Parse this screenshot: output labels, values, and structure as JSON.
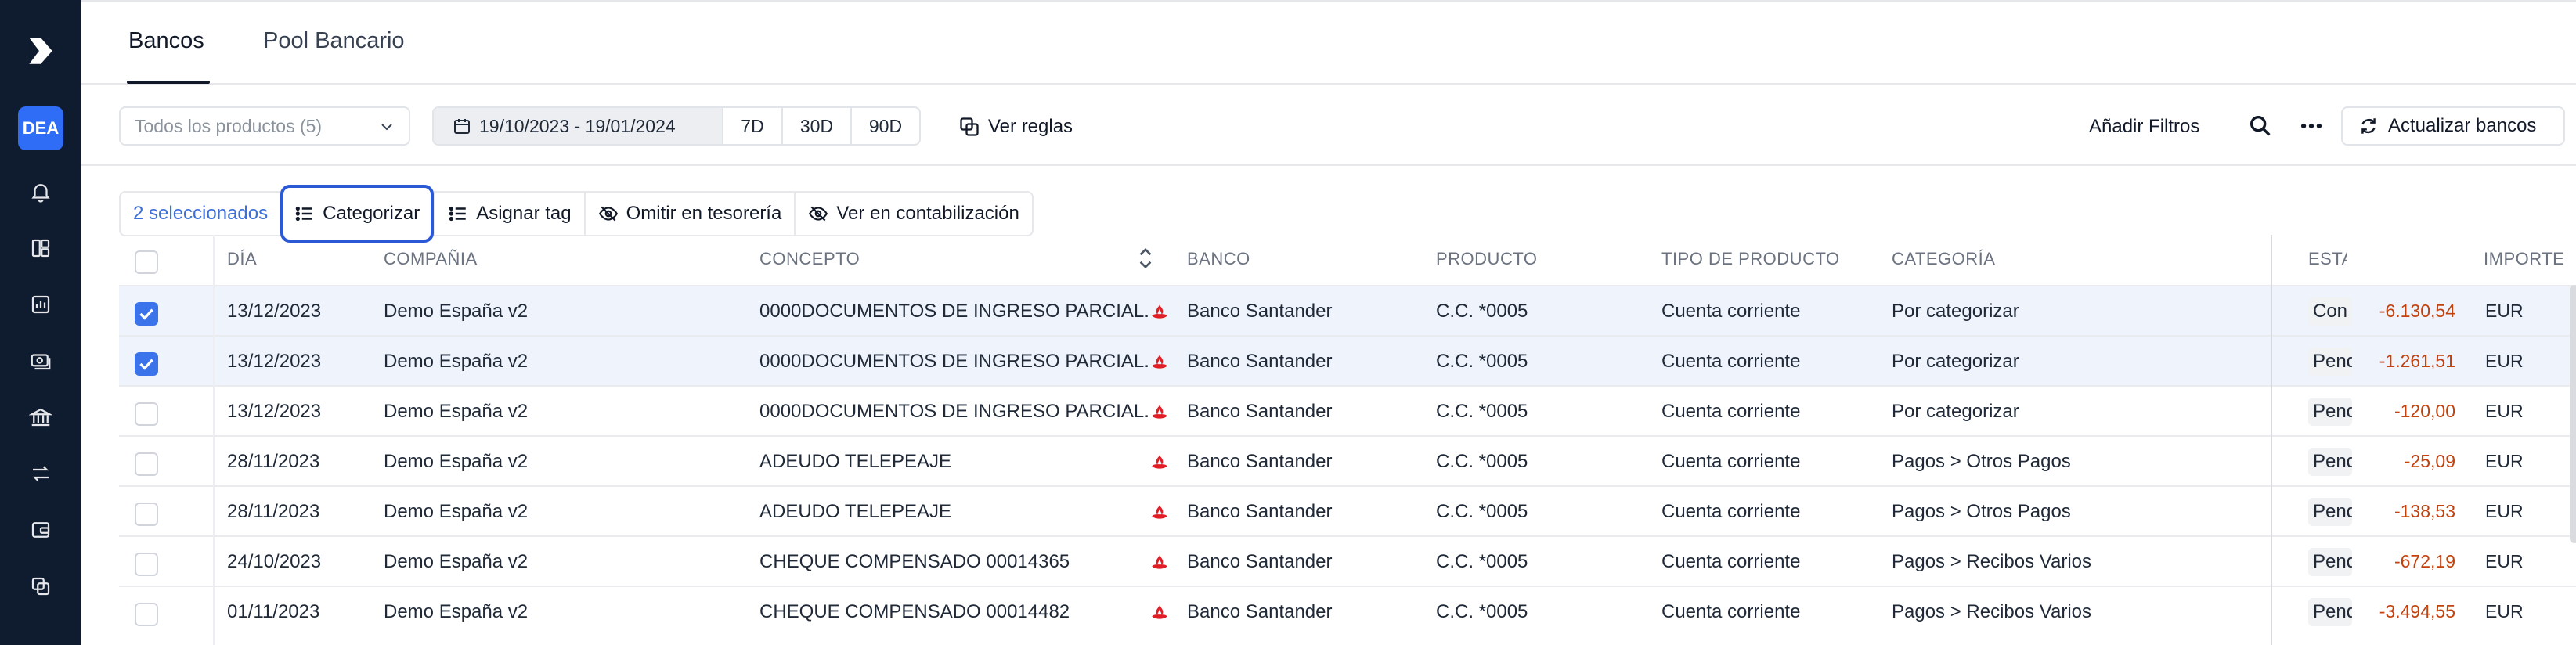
{
  "sidebar": {
    "avatar": "DEA",
    "icons": [
      "bell-icon",
      "layout-icon",
      "report-icon",
      "payments-icon",
      "bank-icon",
      "transfer-icon",
      "wallet-icon",
      "copy-icon"
    ]
  },
  "tabs": [
    {
      "label": "Bancos",
      "active": true
    },
    {
      "label": "Pool Bancario",
      "active": false
    }
  ],
  "filters": {
    "product_select": "Todos los productos (5)",
    "date_range": "19/10/2023 - 19/01/2024",
    "ranges": [
      "7D",
      "30D",
      "90D"
    ],
    "ver_reglas": "Ver reglas",
    "add_filters": "Añadir Filtros",
    "refresh": "Actualizar bancos"
  },
  "bulk_actions": {
    "selected": "2 seleccionados",
    "categorize": "Categorizar",
    "assign_tag": "Asignar tag",
    "omit_treasury": "Omitir en tesorería",
    "view_accounting": "Ver en contabilización"
  },
  "table": {
    "columns": {
      "day": "DÍA",
      "company": "COMPAÑIA",
      "concept": "CONCEPTO",
      "bank": "BANCO",
      "product": "PRODUCTO",
      "product_type": "TIPO DE PRODUCTO",
      "category": "CATEGORÍA",
      "status": "ESTA",
      "amount": "IMPORTE"
    },
    "rows": [
      {
        "selected": true,
        "day": "13/12/2023",
        "company": "Demo España v2",
        "concept": "0000DOCUMENTOS DE INGRESO PARCIAL.",
        "bank": "Banco Santander",
        "product": "C.C. *0005",
        "product_type": "Cuenta corriente",
        "category": "Por categorizar",
        "status": "Con",
        "amount": "-6.130,54",
        "currency": "EUR"
      },
      {
        "selected": true,
        "day": "13/12/2023",
        "company": "Demo España v2",
        "concept": "0000DOCUMENTOS DE INGRESO PARCIAL.",
        "bank": "Banco Santander",
        "product": "C.C. *0005",
        "product_type": "Cuenta corriente",
        "category": "Por categorizar",
        "status": "Pend",
        "amount": "-1.261,51",
        "currency": "EUR"
      },
      {
        "selected": false,
        "day": "13/12/2023",
        "company": "Demo España v2",
        "concept": "0000DOCUMENTOS DE INGRESO PARCIAL.",
        "bank": "Banco Santander",
        "product": "C.C. *0005",
        "product_type": "Cuenta corriente",
        "category": "Por categorizar",
        "status": "Pend",
        "amount": "-120,00",
        "currency": "EUR"
      },
      {
        "selected": false,
        "day": "28/11/2023",
        "company": "Demo España v2",
        "concept": "ADEUDO TELEPEAJE",
        "bank": "Banco Santander",
        "product": "C.C. *0005",
        "product_type": "Cuenta corriente",
        "category": "Pagos > Otros Pagos",
        "status": "Pend",
        "amount": "-25,09",
        "currency": "EUR"
      },
      {
        "selected": false,
        "day": "28/11/2023",
        "company": "Demo España v2",
        "concept": "ADEUDO TELEPEAJE",
        "bank": "Banco Santander",
        "product": "C.C. *0005",
        "product_type": "Cuenta corriente",
        "category": "Pagos > Otros Pagos",
        "status": "Pend",
        "amount": "-138,53",
        "currency": "EUR"
      },
      {
        "selected": false,
        "day": "24/10/2023",
        "company": "Demo España v2",
        "concept": "CHEQUE COMPENSADO 00014365",
        "bank": "Banco Santander",
        "product": "C.C. *0005",
        "product_type": "Cuenta corriente",
        "category": "Pagos > Recibos Varios",
        "status": "Pend",
        "amount": "-672,19",
        "currency": "EUR"
      },
      {
        "selected": false,
        "day": "01/11/2023",
        "company": "Demo España v2",
        "concept": "CHEQUE COMPENSADO 00014482",
        "bank": "Banco Santander",
        "product": "C.C. *0005",
        "product_type": "Cuenta corriente",
        "category": "Pagos > Recibos Varios",
        "status": "Pend",
        "amount": "-3.494,55",
        "currency": "EUR"
      }
    ]
  },
  "colors": {
    "sidebar": "#0f1b2e",
    "accent": "#3b74ea",
    "negative_amount": "#c2410c",
    "selected_row": "#eef3fc"
  }
}
